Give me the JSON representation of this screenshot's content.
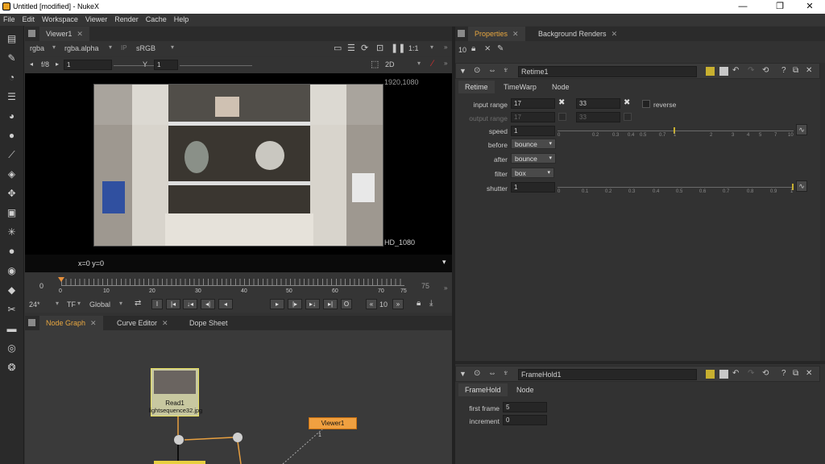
{
  "window": {
    "title": "Untitled [modified] - NukeX",
    "minimize": "—",
    "maximize": "❐",
    "close": "✕"
  },
  "menu": [
    "File",
    "Edit",
    "Workspace",
    "Viewer",
    "Render",
    "Cache",
    "Help"
  ],
  "viewer_panel": {
    "tab": "Viewer1",
    "channels": "rgba",
    "alpha": "rgba.alpha",
    "ip": "IP",
    "colorspace": "sRGB",
    "zoom": "1:1",
    "fstop": "f/8",
    "frame_field": "1",
    "y_label": "Y",
    "y_field": "1",
    "view_mode": "2D",
    "format_top": "1920,1080",
    "format_bottom": "HD_1080",
    "coords": "x=0 y=0",
    "timeline": {
      "start": "0",
      "end": "75",
      "ticks": [
        "0",
        "10",
        "20",
        "30",
        "40",
        "50",
        "60",
        "70",
        "75"
      ],
      "current": 0
    },
    "fps": "24*",
    "tf": "TF",
    "scope": "Global",
    "frame_step": "10"
  },
  "bottom_tabs": [
    "Node Graph",
    "Curve Editor",
    "Dope Sheet"
  ],
  "nodes": {
    "read": {
      "name": "Read1",
      "file": "lightsequence32.jpg"
    },
    "viewer": {
      "name": "Viewer1",
      "input": "1"
    }
  },
  "properties_panel": {
    "tabs": [
      "Properties",
      "Background Renders"
    ],
    "max_panels": "10",
    "retime": {
      "name": "Retime1",
      "tabs": [
        "Retime",
        "TimeWarp",
        "Node"
      ],
      "input_range_label": "input range",
      "input_start": "17",
      "input_end": "33",
      "reverse_label": "reverse",
      "output_range_label": "output range",
      "output_start": "17",
      "output_end": "33",
      "speed_label": "speed",
      "speed": "1",
      "speed_ticks": [
        "0",
        "0.2",
        "0.3",
        "0.4",
        "0.5",
        "0.7",
        "1",
        "2",
        "3",
        "4",
        "5",
        "7",
        "10"
      ],
      "before_label": "before",
      "before": "bounce",
      "after_label": "after",
      "after": "bounce",
      "filter_label": "filter",
      "filter": "box",
      "shutter_label": "shutter",
      "shutter": "1",
      "shutter_ticks": [
        "0",
        "0.1",
        "0.2",
        "0.3",
        "0.4",
        "0.5",
        "0.6",
        "0.7",
        "0.8",
        "0.9",
        "1"
      ]
    },
    "framehold": {
      "name": "FrameHold1",
      "tabs": [
        "FrameHold",
        "Node"
      ],
      "first_frame_label": "first frame",
      "first_frame": "5",
      "increment_label": "increment",
      "increment": "0"
    }
  }
}
